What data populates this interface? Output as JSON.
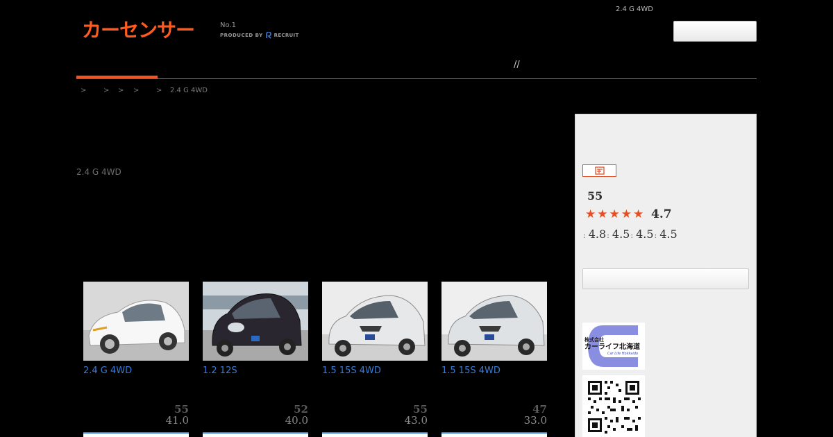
{
  "header": {
    "logo_text": "カーセンサー",
    "tagline_no1": "No.1",
    "tagline_produced": "PRODUCED BY",
    "tagline_brand": "RECRUIT",
    "top_grade": "2.4 G 4WD",
    "search_placeholder": ""
  },
  "nav": {
    "slash_text": "//"
  },
  "breadcrumb": {
    "separators": [
      ">",
      ">",
      ">",
      ">",
      ">"
    ],
    "current": "2.4 G 4WD"
  },
  "page_grade": "2.4 G 4WD",
  "cards": [
    {
      "title": "2.4 G 4WD",
      "score": "55",
      "price": "41.0",
      "photo_icon": "white-hatchback-photo"
    },
    {
      "title": "1.2 12S",
      "score": "52",
      "price": "40.0",
      "photo_icon": "dark-compact-car-photo"
    },
    {
      "title": "1.5 15S 4WD",
      "score": "55",
      "price": "43.0",
      "photo_icon": "silver-hatchback-photo"
    },
    {
      "title": "1.5 15S 4WD",
      "score": "47",
      "price": "33.0",
      "photo_icon": "silver-hatchback-photo"
    }
  ],
  "sidebar": {
    "review_count": "55",
    "rating_total": "4.7",
    "stars": 5,
    "sub_ratings": [
      {
        "sep": ":",
        "value": "4.8"
      },
      {
        "sep": ":",
        "value": "4.5"
      },
      {
        "sep": ":",
        "value": "4.5"
      },
      {
        "sep": ":",
        "value": "4.5"
      }
    ],
    "button_label": "",
    "shop_logo": {
      "line1": "株式会社",
      "line2": "カーライフ北海道",
      "line3": "Car Life Hokkaido"
    }
  },
  "colors": {
    "accent": "#ff5a1f",
    "link": "#3a7bd5",
    "star": "#e84d1f"
  }
}
